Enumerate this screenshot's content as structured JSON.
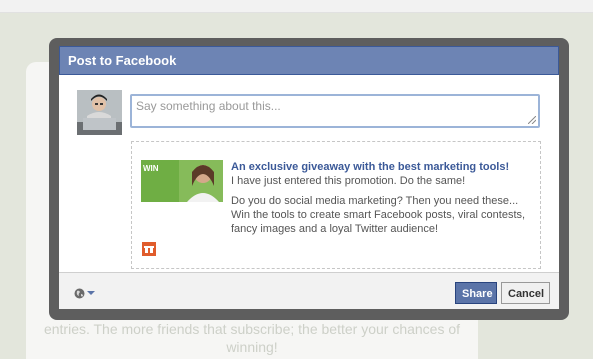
{
  "dialog": {
    "title": "Post to Facebook",
    "message_placeholder": "Say something about this...",
    "share": {
      "title": "An exclusive giveaway with the best marketing tools!",
      "caption": "I have just entered this promotion. Do the same!",
      "description": "Do you do social media marketing? Then you need these... Win the tools to create smart Facebook posts, viral contests, fancy images and a loyal Twitter audience!",
      "thumbnail_text": "WIN"
    },
    "footer": {
      "privacy_icon": "globe-icon",
      "share_label": "Share",
      "cancel_label": "Cancel"
    }
  },
  "background": {
    "text": "entries. The more friends that subscribe; the better your chances of winning!"
  },
  "colors": {
    "header": "#6d84b4",
    "share_button": "#5b74a8",
    "link": "#3b5998"
  }
}
